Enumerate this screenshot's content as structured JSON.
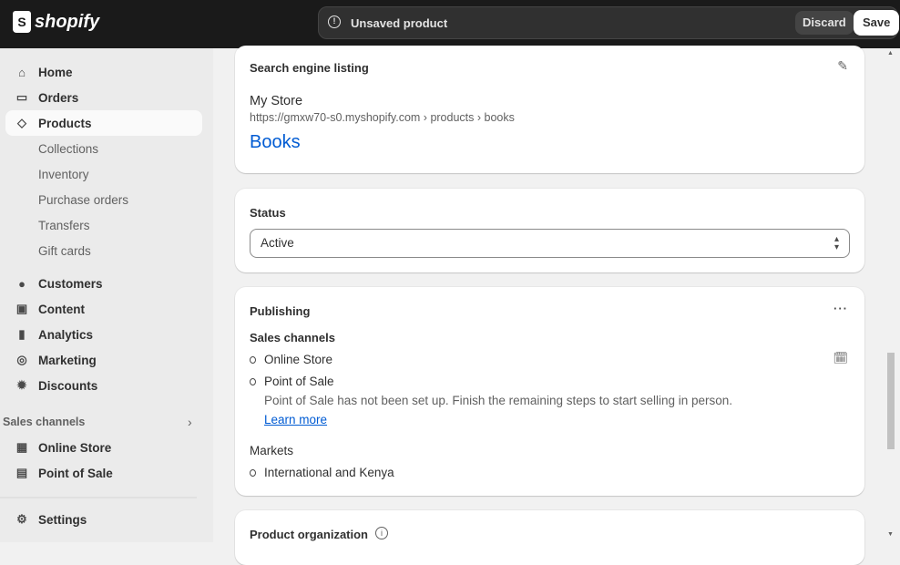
{
  "topbar": {
    "brand": "shopify",
    "unsaved": "Unsaved product",
    "discard": "Discard",
    "save": "Save"
  },
  "sidebar": {
    "main": [
      {
        "label": "Home",
        "icon": "home-icon"
      },
      {
        "label": "Orders",
        "icon": "inbox-icon"
      },
      {
        "label": "Products",
        "icon": "tag-icon",
        "active": true
      }
    ],
    "sub": [
      "Collections",
      "Inventory",
      "Purchase orders",
      "Transfers",
      "Gift cards"
    ],
    "more": [
      {
        "label": "Customers",
        "icon": "person-icon"
      },
      {
        "label": "Content",
        "icon": "image-icon"
      },
      {
        "label": "Analytics",
        "icon": "bar-chart-icon"
      },
      {
        "label": "Marketing",
        "icon": "target-icon"
      },
      {
        "label": "Discounts",
        "icon": "discount-icon"
      }
    ],
    "sales_channels_label": "Sales channels",
    "channels": [
      {
        "label": "Online Store",
        "icon": "store-icon"
      },
      {
        "label": "Point of Sale",
        "icon": "pos-icon"
      }
    ],
    "settings": "Settings"
  },
  "seo": {
    "title": "Search engine listing",
    "store": "My Store",
    "url": "https://gmxw70-s0.myshopify.com › products › books",
    "page_title": "Books",
    "link_color": "#005bd3"
  },
  "status": {
    "title": "Status",
    "value": "Active"
  },
  "publishing": {
    "title": "Publishing",
    "sales_channels": "Sales channels",
    "channels": [
      "Online Store",
      "Point of Sale"
    ],
    "pos_note": "Point of Sale has not been set up. Finish the remaining steps to start selling in person.",
    "learn_more": "Learn more",
    "markets_label": "Markets",
    "markets": [
      "International and Kenya"
    ]
  },
  "organization": {
    "title": "Product organization"
  }
}
